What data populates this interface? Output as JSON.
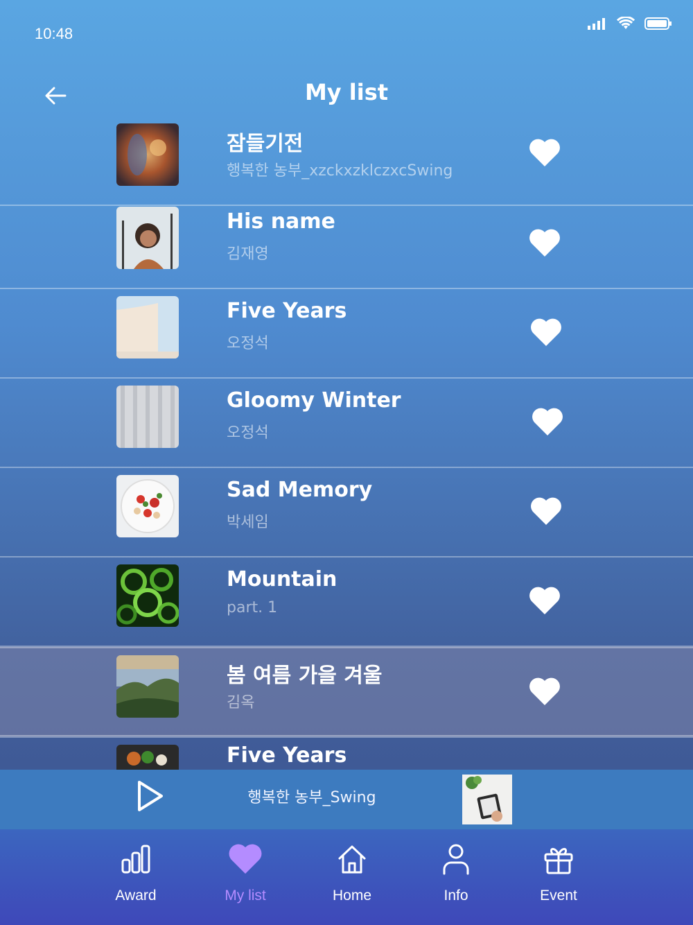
{
  "status_bar": {
    "time": "10:48",
    "icons": [
      "signal-icon",
      "wifi-icon",
      "battery-icon"
    ]
  },
  "header": {
    "title": "My list",
    "back_icon": "arrow-left-icon"
  },
  "songs": [
    {
      "title": "잠들기전",
      "artist": "행복한 농부_xzckxzklczxcSwing",
      "liked": true
    },
    {
      "title": "His name",
      "artist": "김재영",
      "liked": true
    },
    {
      "title": "Five Years",
      "artist": "오정석",
      "liked": true
    },
    {
      "title": "Gloomy Winter",
      "artist": "오정석",
      "liked": true
    },
    {
      "title": "Sad Memory",
      "artist": "박세임",
      "liked": true
    },
    {
      "title": "Mountain",
      "artist": "part. 1",
      "liked": true
    },
    {
      "title": "봄 여름 가을 겨울",
      "artist": "김옥",
      "liked": true,
      "selected": true
    },
    {
      "title": "Five Years",
      "artist": "",
      "liked": true
    }
  ],
  "player": {
    "now_playing": "행복한 농부_Swing",
    "play_icon": "play-icon"
  },
  "tabs": [
    {
      "label": "Award",
      "icon": "bar-chart-icon",
      "active": false
    },
    {
      "label": "My list",
      "icon": "heart-icon",
      "active": true
    },
    {
      "label": "Home",
      "icon": "home-icon",
      "active": false
    },
    {
      "label": "Info",
      "icon": "user-icon",
      "active": false
    },
    {
      "label": "Event",
      "icon": "gift-icon",
      "active": false
    }
  ],
  "colors": {
    "accent": "#b48cff",
    "player_bg": "#3d7bbf",
    "tabbar_bg": "#3e48b9"
  }
}
